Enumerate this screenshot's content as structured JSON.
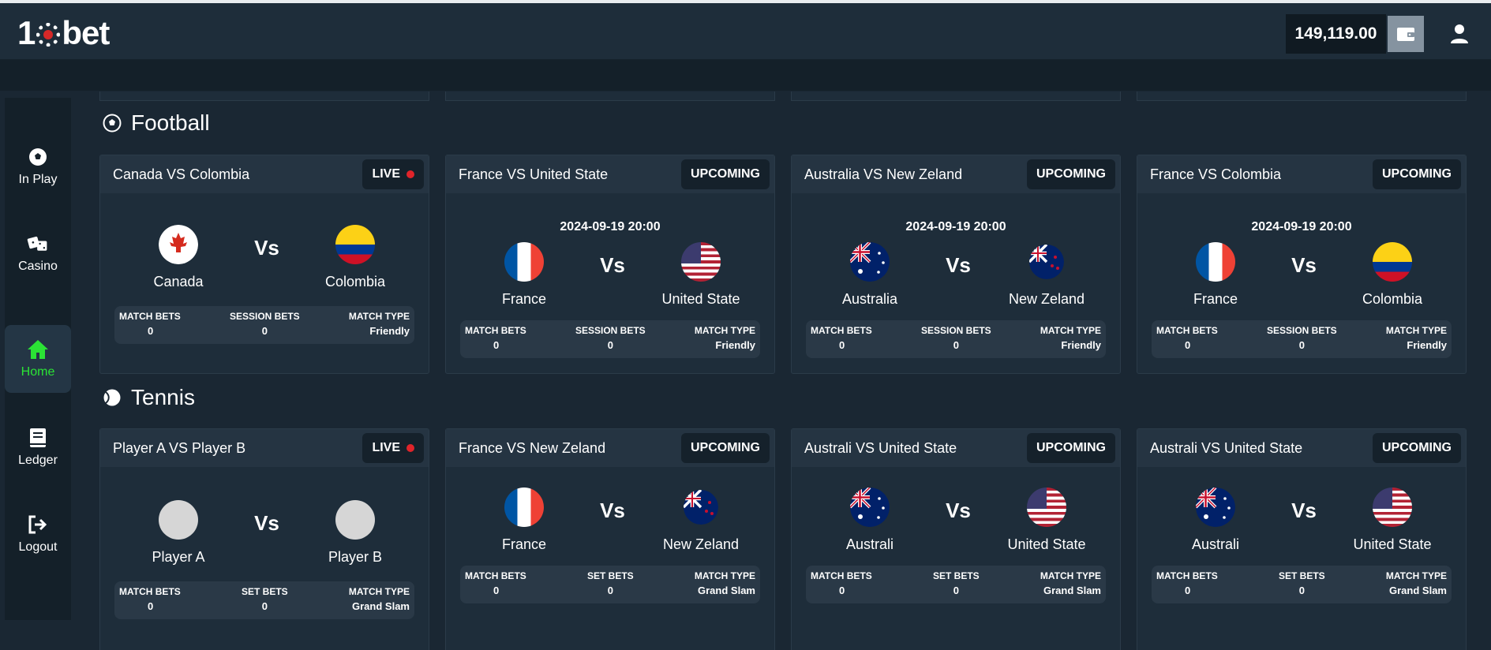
{
  "header": {
    "logo_text": "1",
    "logo_text_b": "bet",
    "balance": "149,119.00"
  },
  "sidebar": {
    "items": [
      {
        "label": "In Play",
        "icon": "soccer-ball-icon"
      },
      {
        "label": "Casino",
        "icon": "dice-icon"
      },
      {
        "label": "Home",
        "icon": "home-icon",
        "active": true
      },
      {
        "label": "Ledger",
        "icon": "book-icon"
      },
      {
        "label": "Logout",
        "icon": "logout-icon"
      }
    ]
  },
  "sections": {
    "football": {
      "title": "Football",
      "cards": [
        {
          "title": "Canada VS Colombia",
          "status": "LIVE",
          "datetime": "",
          "team1": "Canada",
          "team2": "Colombia",
          "vs": "Vs",
          "stat1_label": "MATCH BETS",
          "stat1_value": "0",
          "stat2_label": "SESSION BETS",
          "stat2_value": "0",
          "stat3_label": "MATCH TYPE",
          "stat3_value": "Friendly"
        },
        {
          "title": "France VS United State",
          "status": "UPCOMING",
          "datetime": "2024-09-19 20:00",
          "team1": "France",
          "team2": "United State",
          "vs": "Vs",
          "stat1_label": "MATCH BETS",
          "stat1_value": "0",
          "stat2_label": "SESSION BETS",
          "stat2_value": "0",
          "stat3_label": "MATCH TYPE",
          "stat3_value": "Friendly"
        },
        {
          "title": "Australia VS New Zeland",
          "status": "UPCOMING",
          "datetime": "2024-09-19 20:00",
          "team1": "Australia",
          "team2": "New Zeland",
          "vs": "Vs",
          "stat1_label": "MATCH BETS",
          "stat1_value": "0",
          "stat2_label": "SESSION BETS",
          "stat2_value": "0",
          "stat3_label": "MATCH TYPE",
          "stat3_value": "Friendly"
        },
        {
          "title": "France VS Colombia",
          "status": "UPCOMING",
          "datetime": "2024-09-19 20:00",
          "team1": "France",
          "team2": "Colombia",
          "vs": "Vs",
          "stat1_label": "MATCH BETS",
          "stat1_value": "0",
          "stat2_label": "SESSION BETS",
          "stat2_value": "0",
          "stat3_label": "MATCH TYPE",
          "stat3_value": "Friendly"
        }
      ]
    },
    "tennis": {
      "title": "Tennis",
      "cards": [
        {
          "title": "Player A VS Player B",
          "status": "LIVE",
          "datetime": "",
          "team1": "Player A",
          "team2": "Player B",
          "vs": "Vs",
          "stat1_label": "MATCH BETS",
          "stat1_value": "0",
          "stat2_label": "SET BETS",
          "stat2_value": "0",
          "stat3_label": "MATCH TYPE",
          "stat3_value": "Grand Slam"
        },
        {
          "title": "France VS New Zeland",
          "status": "UPCOMING",
          "datetime": "",
          "team1": "France",
          "team2": "New Zeland",
          "vs": "Vs",
          "stat1_label": "MATCH BETS",
          "stat1_value": "0",
          "stat2_label": "SET BETS",
          "stat2_value": "0",
          "stat3_label": "MATCH TYPE",
          "stat3_value": "Grand Slam"
        },
        {
          "title": "Australi VS United State",
          "status": "UPCOMING",
          "datetime": "",
          "team1": "Australi",
          "team2": "United State",
          "vs": "Vs",
          "stat1_label": "MATCH BETS",
          "stat1_value": "0",
          "stat2_label": "SET BETS",
          "stat2_value": "0",
          "stat3_label": "MATCH TYPE",
          "stat3_value": "Grand Slam"
        },
        {
          "title": "Australi VS United State",
          "status": "UPCOMING",
          "datetime": "",
          "team1": "Australi",
          "team2": "United State",
          "vs": "Vs",
          "stat1_label": "MATCH BETS",
          "stat1_value": "0",
          "stat2_label": "SET BETS",
          "stat2_value": "0",
          "stat3_label": "MATCH TYPE",
          "stat3_value": "Grand Slam"
        }
      ]
    }
  },
  "colors": {
    "background": "#1a2733",
    "card": "#1e2d3a",
    "active_nav": "#2be335",
    "live_dot": "#e0242a"
  }
}
